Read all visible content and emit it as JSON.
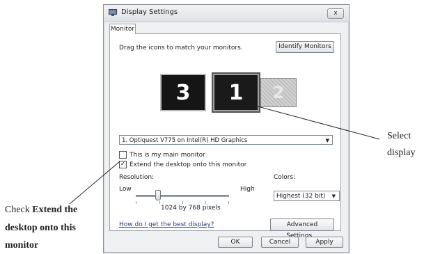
{
  "window": {
    "title": "Display Settings",
    "close_label": "x"
  },
  "tabs": [
    {
      "label": "Monitor"
    }
  ],
  "panel": {
    "instruction": "Drag the icons to match your monitors.",
    "identify_button": "Identify Monitors",
    "monitors": [
      {
        "number": "3"
      },
      {
        "number": "1"
      },
      {
        "number": "2"
      }
    ],
    "display_select": "1. Optiquest V775 on Intel(R) HD Graphics",
    "main_monitor_label": "This is my main monitor",
    "main_monitor_checked": false,
    "extend_label": "Extend the desktop onto this monitor",
    "extend_checked": true,
    "resolution_label": "Resolution:",
    "resolution_low": "Low",
    "resolution_high": "High",
    "resolution_value": "1024 by 768 pixels",
    "colors_label": "Colors:",
    "colors_value": "Highest (32 bit)",
    "help_link": "How do I get the best display?",
    "advanced_button": "Advanced Settings..."
  },
  "footer": {
    "ok": "OK",
    "cancel": "Cancel",
    "apply": "Apply"
  },
  "callouts": {
    "select_display_line1": "Select",
    "select_display_line2": "display",
    "extend_prefix": "Check ",
    "extend_bold_1": "Extend the",
    "extend_bold_2": "desktop onto this",
    "extend_bold_3": "monitor"
  }
}
